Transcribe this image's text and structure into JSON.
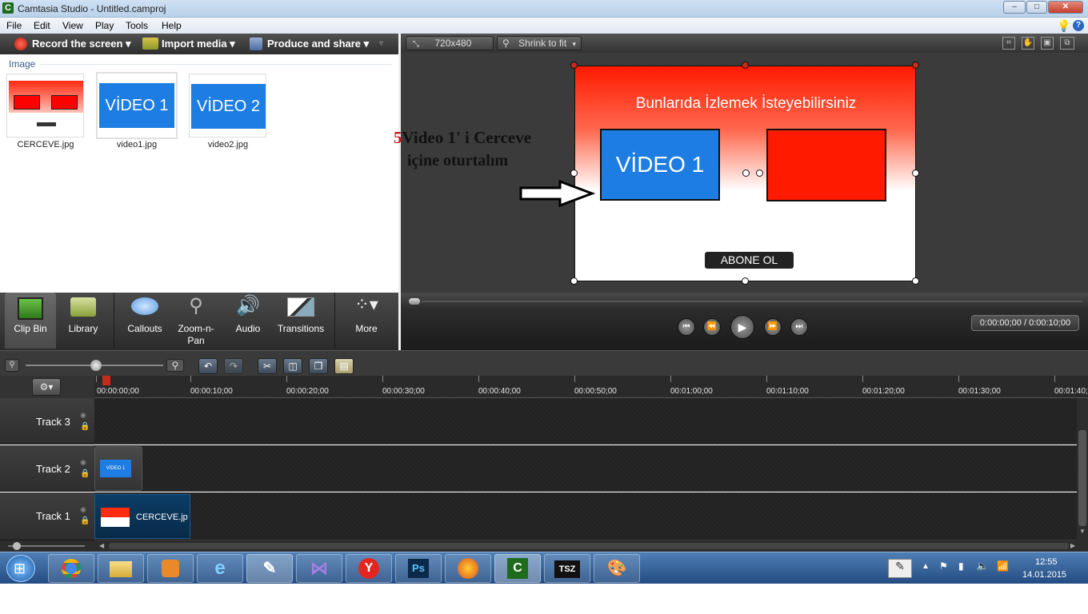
{
  "window": {
    "title": "Camtasia Studio - Untitled.camproj",
    "min": "–",
    "max": "□",
    "close": "✕",
    "app_letter": "C"
  },
  "menu": {
    "items": [
      "File",
      "Edit",
      "View",
      "Play",
      "Tools",
      "Help"
    ]
  },
  "toolbar": {
    "record": "Record the screen",
    "import": "Import media",
    "produce": "Produce and share"
  },
  "clip_bin": {
    "section": "Image",
    "items": [
      {
        "name": "CERCEVE.jpg"
      },
      {
        "name": "video1.jpg",
        "thumb_text": "VİDEO 1"
      },
      {
        "name": "video2.jpg",
        "thumb_text": "VİDEO 2"
      }
    ]
  },
  "tabs": {
    "clip_bin": "Clip Bin",
    "library": "Library",
    "callouts": "Callouts",
    "zoom_a": "Zoom-n-",
    "zoom_b": "Pan",
    "audio": "Audio",
    "transitions": "Transitions",
    "more": "More"
  },
  "preview": {
    "dimensions": "720x480",
    "zoom": "Shrink to fit",
    "canvas_title": "Bunlarıda İzlemek İsteyebilirsiniz",
    "video_box": "VİDEO 1",
    "subscribe": "ABONE OL",
    "time": "0:00:00;00 / 0:00:10;00"
  },
  "annotation": {
    "number": "5",
    "line1": "Video 1' i Cerceve",
    "line2": "içine oturtalım"
  },
  "timeline": {
    "ticks": [
      "00:00:00;00",
      "00:00:10;00",
      "00:00:20;00",
      "00:00:30;00",
      "00:00:40;00",
      "00:00:50;00",
      "00:01:00;00",
      "00:01:10;00",
      "00:01:20;00",
      "00:01:30;00",
      "00:01:40;"
    ],
    "tracks": [
      {
        "name": "Track 3"
      },
      {
        "name": "Track 2",
        "clip_text": "VİDEO 1"
      },
      {
        "name": "Track 1",
        "clip_text": "CERCEVE.jp"
      }
    ]
  },
  "taskbar": {
    "clock_time": "12:55",
    "clock_date": "14.01.2015",
    "ps_label": "Ps",
    "tsz_label": "TSZ"
  },
  "colors": {
    "accent_red": "#ff1a00",
    "video_blue": "#1e7de2",
    "dark_bg": "#2a2a2a"
  }
}
